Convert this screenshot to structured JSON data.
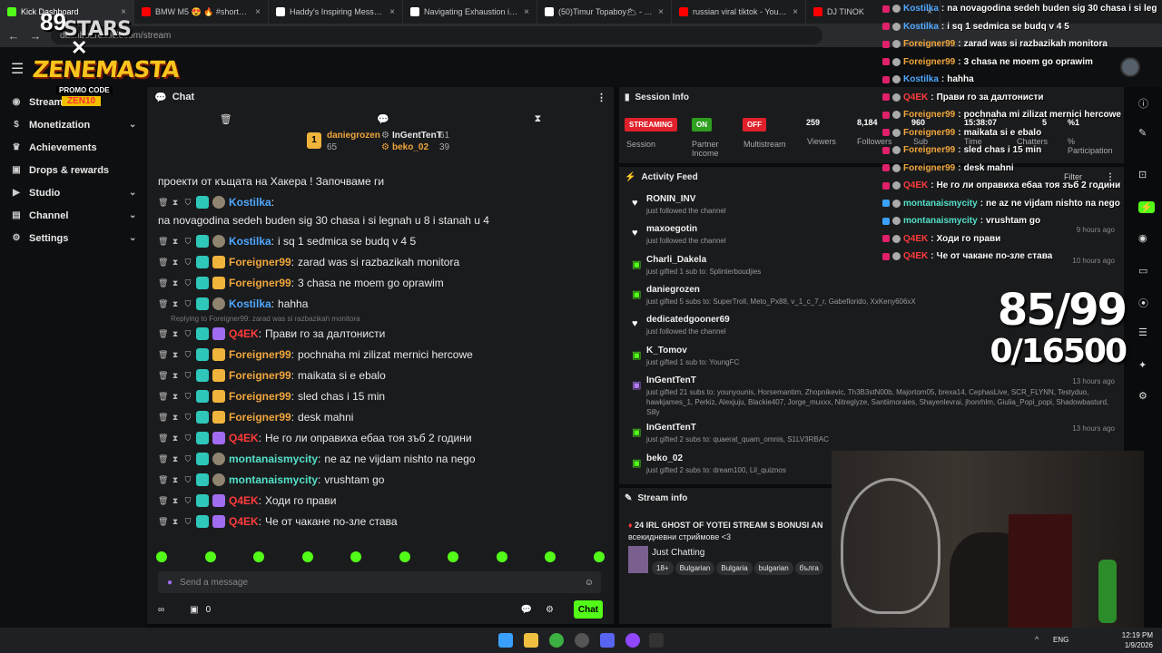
{
  "tabs": [
    {
      "label": "Kick Dashboard",
      "color": "#53fc18"
    },
    {
      "label": "BMW M5 😍 🔥 #shortsvideo",
      "color": "#ff0000"
    },
    {
      "label": "Haddy's Inspiring Message Afte",
      "color": "#ffffff"
    },
    {
      "label": "Navigating Exhaustion in Mode",
      "color": "#ffffff"
    },
    {
      "label": "(50)Timur Topaboy🌥 - оригин",
      "color": "#ffffff"
    },
    {
      "label": "russian viral tiktok - YouTube",
      "color": "#ff0000"
    },
    {
      "label": "DJ TINOK",
      "color": "#ff0000"
    }
  ],
  "address": {
    "url": "dashboard.kick.com/stream"
  },
  "logo": {
    "top": "89",
    "stars": "STARS",
    "x": "✕",
    "main": "ZENEMASTA",
    "promo": "PROMO CODE",
    "code": "ZEN10"
  },
  "sidebar": {
    "items": [
      {
        "label": "Stream",
        "icon": "broadcast-icon",
        "chev": ""
      },
      {
        "label": "Monetization",
        "icon": "dollar-icon",
        "chev": "⌄"
      },
      {
        "label": "Achievements",
        "icon": "trophy-icon",
        "chev": ""
      },
      {
        "label": "Drops & rewards",
        "icon": "gift-icon",
        "chev": ""
      },
      {
        "label": "Studio",
        "icon": "video-icon",
        "chev": "⌄"
      },
      {
        "label": "Channel",
        "icon": "channel-icon",
        "chev": "⌄"
      },
      {
        "label": "Settings",
        "icon": "gear-icon",
        "chev": "⌄"
      }
    ]
  },
  "chat": {
    "title": "Chat",
    "leaders": [
      {
        "name": "daniegrozen",
        "count": "65",
        "rank": "1"
      },
      {
        "name": "InGentTenT",
        "count": "61"
      },
      {
        "name": "beko_02",
        "count": "39"
      }
    ],
    "first_line": "проекти от къщата на Хакера ! Започваме ги",
    "messages": [
      {
        "name": "Kostilka",
        "color": "#4fa8ff",
        "text": "na novagodina sedeh buden sig 30 chasa i si legnah u 8 i stanah u 4",
        "badge": "b-teal"
      },
      {
        "name": "Kostilka",
        "color": "#4fa8ff",
        "text": "i sq 1 sedmica se budq v 4 5",
        "badge": "b-teal"
      },
      {
        "name": "Foreigner99",
        "color": "#f0a63c",
        "text": "zarad was si razbazikah monitora",
        "badge": "b-gold"
      },
      {
        "name": "Foreigner99",
        "color": "#f0a63c",
        "text": "3 chasa ne moem go oprawim",
        "badge": "b-gold"
      },
      {
        "name": "Kostilka",
        "color": "#4fa8ff",
        "text": "hahha",
        "badge": "b-teal"
      },
      {
        "name": "Q4EK",
        "color": "#ff3b3b",
        "text": "Прави го за далтонисти",
        "badge": "b-pur",
        "reply": "Replying to Foreigner99: zarad was si razbazikah monitora"
      },
      {
        "name": "Foreigner99",
        "color": "#f0a63c",
        "text": "pochnaha mi zilizat mernici hercowe",
        "badge": "b-gold"
      },
      {
        "name": "Foreigner99",
        "color": "#f0a63c",
        "text": "maikata si e ebalo",
        "badge": "b-gold"
      },
      {
        "name": "Foreigner99",
        "color": "#f0a63c",
        "text": "sled chas i 15 min",
        "badge": "b-gold"
      },
      {
        "name": "Foreigner99",
        "color": "#f0a63c",
        "text": "desk mahni",
        "badge": "b-gold"
      },
      {
        "name": "Q4EK",
        "color": "#ff3b3b",
        "text": "Не го ли оправиха ебаа тоя зъб 2 години",
        "badge": "b-pur"
      },
      {
        "name": "montanaismycity",
        "color": "#53e0c8",
        "text": "ne az ne vijdam nishto na nego",
        "badge": "b-teal"
      },
      {
        "name": "montanaismycity",
        "color": "#53e0c8",
        "text": "vrushtam go",
        "badge": "b-teal"
      },
      {
        "name": "Q4EK",
        "color": "#ff3b3b",
        "text": "Ходи го прави",
        "badge": "b-pur"
      },
      {
        "name": "Q4EK",
        "color": "#ff3b3b",
        "text": "Че от чакане по-зле става",
        "badge": "b-pur"
      }
    ],
    "input_placeholder": "Send a message",
    "footer_count": "0",
    "send_label": "Chat"
  },
  "session": {
    "title": "Session Info",
    "streaming": "STREAMING",
    "streaming_label": "Session",
    "partner": "ON",
    "partner_label": "Partner Income",
    "multistream": "OFF",
    "multistream_label": "Multistream",
    "viewers": "259",
    "viewers_label": "Viewers",
    "followers": "8,184",
    "followers_label": "Followers",
    "subs": "960",
    "subs_label": "Sub",
    "time": "15:38:07",
    "time_label": "Time",
    "chatters": "5",
    "chatters_label": "Chatters",
    "participation": "%1",
    "participation_label": "% Participation"
  },
  "activity": {
    "title": "Activity Feed",
    "filter": "Filter",
    "items": [
      {
        "name": "RONIN_INV",
        "desc": "just followed the channel",
        "time": "",
        "icon": "heart-icon"
      },
      {
        "name": "maxoegotin",
        "desc": "just followed the channel",
        "time": "9 hours ago",
        "icon": "heart-icon"
      },
      {
        "name": "Charli_Dakela",
        "desc": "just gifted 1 sub to: Splinterboudjies",
        "time": "10 hours ago",
        "icon": "gift-icon"
      },
      {
        "name": "daniegrozen",
        "desc": "just gifted 5 subs to: SuperTroll, Meto_Px88, v_1_c_7_r, Gabeflorido, XxKeny606xX",
        "time": "",
        "icon": "gift-icon"
      },
      {
        "name": "dedicatedgooner69",
        "desc": "just followed the channel",
        "time": "",
        "icon": "heart-icon"
      },
      {
        "name": "K_Tomov",
        "desc": "just gifted 1 sub to: YoungFC",
        "time": "",
        "icon": "gift-icon"
      },
      {
        "name": "InGentTenT",
        "desc": "just gifted 21 subs to: younyounis, Horsemantim, Zhopnikevic, Th3B3stN00b, Majortom05, brexa14, CephasLive, SCR_FLYNN, Testyduo, hawkjames_1, Perkiz, Alexjuju, Blackie407, Jorge_muxxx, Nitreglyze, Santiimorales, Shayenlevrai, jhonrhlm, Giulia_Popi_popi, Shadowbasturd, Silly",
        "time": "13 hours ago",
        "icon": "gift-icon-purple"
      },
      {
        "name": "InGentTenT",
        "desc": "just gifted 2 subs to: quaerat_quam_omnis, S1LV3RBAC",
        "time": "13 hours ago",
        "icon": "gift-icon"
      },
      {
        "name": "beko_02",
        "desc": "just gifted 2 subs to: dream100, Lil_quiznos",
        "time": "13 hours ago",
        "icon": "gift-icon"
      }
    ]
  },
  "stream_info": {
    "title": "Stream info",
    "stream_title": "24 IRL GHOST OF YOTEI STREAM S BONUSI AN",
    "stream_sub": "всекидневни стриймове <3",
    "category": "Just Chatting",
    "tags": [
      "18+",
      "Bulgarian",
      "Bulgaria",
      "bulgarian",
      "бълга"
    ]
  },
  "overlay": [
    {
      "name": "Kostilka",
      "color": "#4fa8ff",
      "text": "na novagodina sedeh buden sig 30 chasa i si leg"
    },
    {
      "name": "Kostilka",
      "color": "#4fa8ff",
      "text": "i sq 1 sedmica se budq v 4 5"
    },
    {
      "name": "Foreigner99",
      "color": "#f0a63c",
      "text": "zarad was si razbazikah monitora"
    },
    {
      "name": "Foreigner99",
      "color": "#f0a63c",
      "text": "3 chasa ne moem go oprawim"
    },
    {
      "name": "Kostilka",
      "color": "#4fa8ff",
      "text": "hahha"
    },
    {
      "name": "Q4EK",
      "color": "#ff3b3b",
      "text": "Прави го за далтонисти"
    },
    {
      "name": "Foreigner99",
      "color": "#f0a63c",
      "text": "pochnaha mi zilizat mernici hercowe"
    },
    {
      "name": "Foreigner99",
      "color": "#f0a63c",
      "text": "maikata si e ebalo"
    },
    {
      "name": "Foreigner99",
      "color": "#f0a63c",
      "text": "sled chas i 15 min"
    },
    {
      "name": "Foreigner99",
      "color": "#f0a63c",
      "text": "desk mahni"
    },
    {
      "name": "Q4EK",
      "color": "#ff3b3b",
      "text": "Не го ли оправиха ебаа тоя зъб 2 години"
    },
    {
      "name": "montanaismycity",
      "color": "#53e0c8",
      "text": "ne az ne vijdam nishto na nego"
    },
    {
      "name": "montanaismycity",
      "color": "#53e0c8",
      "text": "vrushtam go"
    },
    {
      "name": "Q4EK",
      "color": "#ff3b3b",
      "text": "Ходи го прави"
    },
    {
      "name": "Q4EK",
      "color": "#ff3b3b",
      "text": "Че от чакане по-зле става"
    }
  ],
  "counter": {
    "line1": "85/99",
    "line2": "0/16500"
  },
  "taskbar": {
    "lang": "ENG",
    "time": "12:19 PM",
    "date": "1/9/2026"
  }
}
